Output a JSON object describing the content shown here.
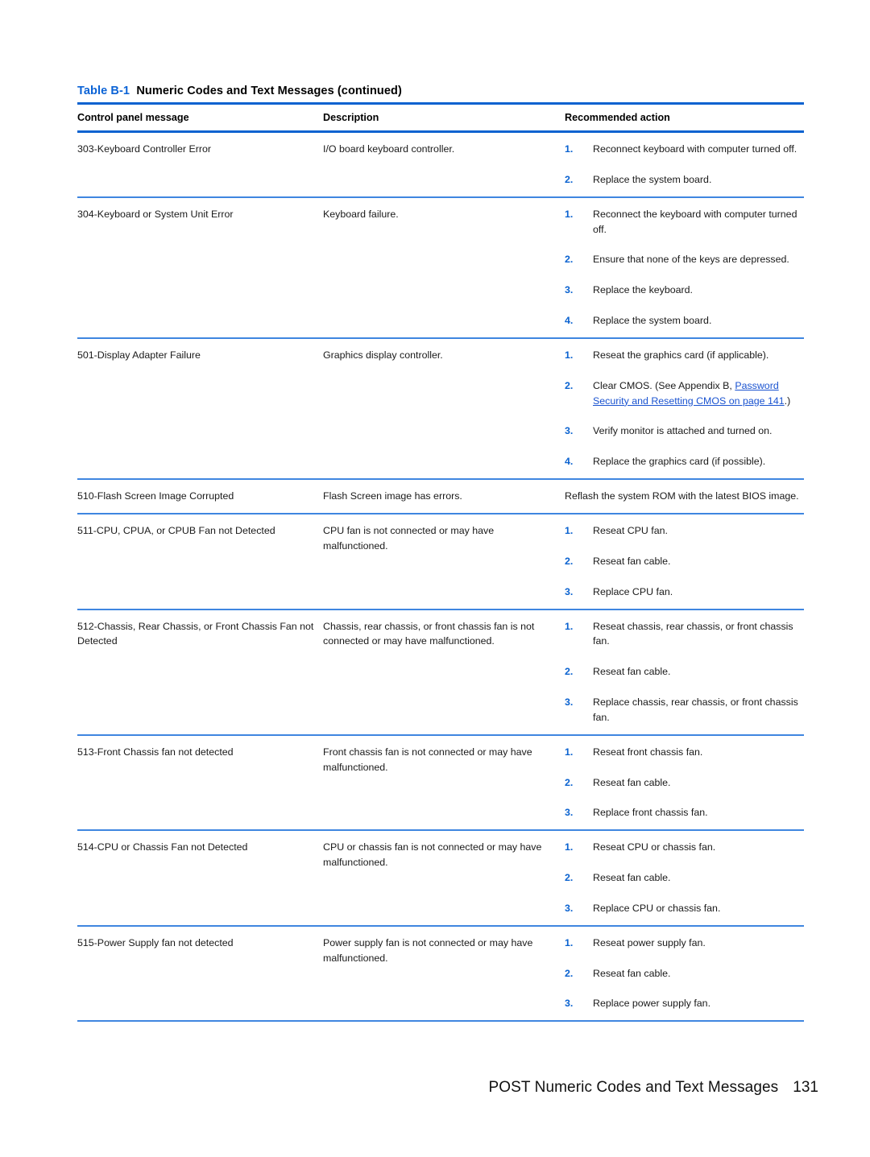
{
  "table": {
    "caption_label": "Table B-1",
    "caption_title": "Numeric Codes and Text Messages (continued)",
    "headers": {
      "col1": "Control panel message",
      "col2": "Description",
      "col3": "Recommended action"
    },
    "rows": [
      {
        "message": "303-Keyboard Controller Error",
        "description": "I/O board keyboard controller.",
        "actions": [
          {
            "num": "1.",
            "text": "Reconnect keyboard with computer turned off."
          },
          {
            "num": "2.",
            "text": "Replace the system board."
          }
        ]
      },
      {
        "message": "304-Keyboard or System Unit Error",
        "description": "Keyboard failure.",
        "actions": [
          {
            "num": "1.",
            "text": "Reconnect the keyboard with computer turned off."
          },
          {
            "num": "2.",
            "text": "Ensure that none of the keys are depressed."
          },
          {
            "num": "3.",
            "text": "Replace the keyboard."
          },
          {
            "num": "4.",
            "text": "Replace the system board."
          }
        ]
      },
      {
        "message": "501-Display Adapter Failure",
        "description": "Graphics display controller.",
        "actions": [
          {
            "num": "1.",
            "text": "Reseat the graphics card (if applicable)."
          },
          {
            "num": "2.",
            "text_before": "Clear CMOS. (See Appendix B, ",
            "link_text": "Password Security and Resetting CMOS on page 141",
            "text_after": ".)"
          },
          {
            "num": "3.",
            "text": "Verify monitor is attached and turned on."
          },
          {
            "num": "4.",
            "text": "Replace the graphics card (if possible)."
          }
        ]
      },
      {
        "message": "510-Flash Screen Image Corrupted",
        "description": "Flash Screen image has errors.",
        "plain_action": "Reflash the system ROM with the latest BIOS image."
      },
      {
        "message": "511-CPU, CPUA, or CPUB Fan not Detected",
        "description": "CPU fan is not connected or may have malfunctioned.",
        "actions": [
          {
            "num": "1.",
            "text": "Reseat CPU fan."
          },
          {
            "num": "2.",
            "text": "Reseat fan cable."
          },
          {
            "num": "3.",
            "text": "Replace CPU fan."
          }
        ]
      },
      {
        "message": "512-Chassis, Rear Chassis, or Front Chassis Fan not Detected",
        "description": "Chassis, rear chassis, or front chassis fan is not connected or may have malfunctioned.",
        "actions": [
          {
            "num": "1.",
            "text": "Reseat chassis, rear chassis, or front chassis fan."
          },
          {
            "num": "2.",
            "text": "Reseat fan cable."
          },
          {
            "num": "3.",
            "text": "Replace chassis, rear chassis, or front chassis fan."
          }
        ]
      },
      {
        "message": "513-Front Chassis fan not detected",
        "description": "Front chassis fan is not connected or may have malfunctioned.",
        "actions": [
          {
            "num": "1.",
            "text": "Reseat front chassis fan."
          },
          {
            "num": "2.",
            "text": "Reseat fan cable."
          },
          {
            "num": "3.",
            "text": "Replace front chassis fan."
          }
        ]
      },
      {
        "message": "514-CPU or Chassis Fan not Detected",
        "description": "CPU or chassis fan is not connected or may have malfunctioned.",
        "actions": [
          {
            "num": "1.",
            "text": "Reseat CPU or chassis fan."
          },
          {
            "num": "2.",
            "text": "Reseat fan cable."
          },
          {
            "num": "3.",
            "text": "Replace CPU or chassis fan."
          }
        ]
      },
      {
        "message": "515-Power Supply fan not detected",
        "description": "Power supply fan is not connected or may have malfunctioned.",
        "actions": [
          {
            "num": "1.",
            "text": "Reseat power supply fan."
          },
          {
            "num": "2.",
            "text": "Reseat fan cable."
          },
          {
            "num": "3.",
            "text": "Replace power supply fan."
          }
        ]
      }
    ]
  },
  "footer": {
    "title": "POST Numeric Codes and Text Messages",
    "page_number": "131"
  },
  "colors": {
    "accent_blue": "#0a62d0",
    "rule_blue": "#3f86e0",
    "link_blue": "#1a53d0"
  }
}
